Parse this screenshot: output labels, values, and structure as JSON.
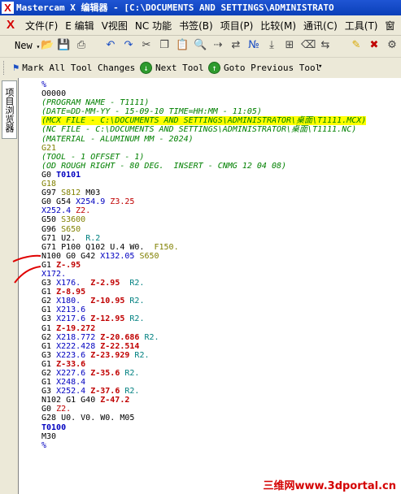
{
  "window": {
    "title": "Mastercam X 编辑器 - [C:\\DOCUMENTS AND SETTINGS\\ADMINISTRATO",
    "logo_char": "X"
  },
  "menubar": {
    "items": [
      "文件(F)",
      "E 编辑",
      "V视图",
      "NC 功能",
      "书签(B)",
      "项目(P)",
      "比较(M)",
      "通讯(C)",
      "工具(T)",
      "窗"
    ]
  },
  "toolbar1": {
    "new_label": "New",
    "icons": [
      "open-icon",
      "save-icon",
      "print-icon",
      "undo-icon",
      "redo-icon",
      "cut-icon",
      "copy-icon",
      "paste-icon",
      "find-icon",
      "find-next-icon",
      "replace-icon",
      "renumber-icon",
      "goto-icon",
      "insert-icon",
      "clear-icon",
      "compare-icon",
      "bookmark-icon",
      "send-icon",
      "tool-icon",
      "close-icon",
      "settings-icon"
    ]
  },
  "toolbar2": {
    "mark_all": "Mark All Tool Changes",
    "next_tool": "Next Tool",
    "goto_previous": "Goto Previous Tool"
  },
  "sidepanel": {
    "tab_label": "项目浏览器"
  },
  "code": {
    "lines": [
      [
        {
          "t": "%",
          "c": "gutter"
        }
      ],
      [
        {
          "t": "O0000",
          "c": "normal"
        }
      ],
      [
        {
          "t": "(PROGRAM NAME - T1111)",
          "c": "comment"
        }
      ],
      [
        {
          "t": "(DATE=DD-MM-YY - 15-09-10 TIME=HH:MM - 11:05)",
          "c": "comment"
        }
      ],
      [
        {
          "t": "(MCX FILE - C:\\DOCUMENTS AND SETTINGS\\ADMINISTRATOR\\桌面\\T1111.MCX)",
          "c": "comment hl"
        }
      ],
      [
        {
          "t": "(NC FILE - C:\\DOCUMENTS AND SETTINGS\\ADMINISTRATOR\\桌面\\T1111.NC)",
          "c": "comment"
        }
      ],
      [
        {
          "t": "(MATERIAL - ALUMINUM MM - 2024)",
          "c": "comment"
        }
      ],
      [
        {
          "t": "G21",
          "c": "olive"
        }
      ],
      [
        {
          "t": "(TOOL - 1 OFFSET - 1)",
          "c": "comment"
        }
      ],
      [
        {
          "t": "(OD ROUGH RIGHT - 80 DEG.  INSERT - CNMG 12 04 08)",
          "c": "comment"
        }
      ],
      [
        {
          "t": "G0 ",
          "c": "normal"
        },
        {
          "t": "T0101",
          "c": "blue bold"
        }
      ],
      [
        {
          "t": "G18",
          "c": "olive"
        }
      ],
      [
        {
          "t": "G97 ",
          "c": "normal"
        },
        {
          "t": "S812",
          "c": "olive"
        },
        {
          "t": " M03",
          "c": "normal"
        }
      ],
      [
        {
          "t": "G0 G54 ",
          "c": "normal"
        },
        {
          "t": "X254.9",
          "c": "blue"
        },
        {
          "t": " ",
          "c": "normal"
        },
        {
          "t": "Z3.25",
          "c": "red"
        }
      ],
      [
        {
          "t": "X252.4",
          "c": "blue"
        },
        {
          "t": " ",
          "c": "normal"
        },
        {
          "t": "Z2.",
          "c": "red"
        }
      ],
      [
        {
          "t": "G50 ",
          "c": "normal"
        },
        {
          "t": "S3600",
          "c": "olive"
        }
      ],
      [
        {
          "t": "G96 ",
          "c": "normal"
        },
        {
          "t": "S650",
          "c": "olive"
        }
      ],
      [
        {
          "t": "G71 U2.  ",
          "c": "normal"
        },
        {
          "t": "R.2",
          "c": "teal"
        }
      ],
      [
        {
          "t": "G71 P100 Q102 U.4 W0.  ",
          "c": "normal"
        },
        {
          "t": "F150.",
          "c": "olive"
        }
      ],
      [
        {
          "t": "N100 G0 G42 ",
          "c": "normal"
        },
        {
          "t": "X132.05",
          "c": "blue"
        },
        {
          "t": " ",
          "c": "normal"
        },
        {
          "t": "S650",
          "c": "olive"
        }
      ],
      [
        {
          "t": "G1 ",
          "c": "normal"
        },
        {
          "t": "Z-.95",
          "c": "red bold"
        }
      ],
      [
        {
          "t": "X172.",
          "c": "blue"
        }
      ],
      [
        {
          "t": "G3 ",
          "c": "normal"
        },
        {
          "t": "X176.",
          "c": "blue"
        },
        {
          "t": "  ",
          "c": "normal"
        },
        {
          "t": "Z-2.95",
          "c": "red bold"
        },
        {
          "t": "  ",
          "c": "normal"
        },
        {
          "t": "R2.",
          "c": "teal"
        }
      ],
      [
        {
          "t": "G1 ",
          "c": "normal"
        },
        {
          "t": "Z-8.95",
          "c": "red bold"
        }
      ],
      [
        {
          "t": "G2 ",
          "c": "normal"
        },
        {
          "t": "X180.",
          "c": "blue"
        },
        {
          "t": "  ",
          "c": "normal"
        },
        {
          "t": "Z-10.95",
          "c": "red bold"
        },
        {
          "t": " ",
          "c": "normal"
        },
        {
          "t": "R2.",
          "c": "teal"
        }
      ],
      [
        {
          "t": "G1 ",
          "c": "normal"
        },
        {
          "t": "X213.6",
          "c": "blue"
        }
      ],
      [
        {
          "t": "G3 ",
          "c": "normal"
        },
        {
          "t": "X217.6",
          "c": "blue"
        },
        {
          "t": " ",
          "c": "normal"
        },
        {
          "t": "Z-12.95",
          "c": "red bold"
        },
        {
          "t": " ",
          "c": "normal"
        },
        {
          "t": "R2.",
          "c": "teal"
        }
      ],
      [
        {
          "t": "G1 ",
          "c": "normal"
        },
        {
          "t": "Z-19.272",
          "c": "red bold"
        }
      ],
      [
        {
          "t": "G2 ",
          "c": "normal"
        },
        {
          "t": "X218.772",
          "c": "blue"
        },
        {
          "t": " ",
          "c": "normal"
        },
        {
          "t": "Z-20.686",
          "c": "red bold"
        },
        {
          "t": " ",
          "c": "normal"
        },
        {
          "t": "R2.",
          "c": "teal"
        }
      ],
      [
        {
          "t": "G1 ",
          "c": "normal"
        },
        {
          "t": "X222.428",
          "c": "blue"
        },
        {
          "t": " ",
          "c": "normal"
        },
        {
          "t": "Z-22.514",
          "c": "red bold"
        }
      ],
      [
        {
          "t": "G3 ",
          "c": "normal"
        },
        {
          "t": "X223.6",
          "c": "blue"
        },
        {
          "t": " ",
          "c": "normal"
        },
        {
          "t": "Z-23.929",
          "c": "red bold"
        },
        {
          "t": " ",
          "c": "normal"
        },
        {
          "t": "R2.",
          "c": "teal"
        }
      ],
      [
        {
          "t": "G1 ",
          "c": "normal"
        },
        {
          "t": "Z-33.6",
          "c": "red bold"
        }
      ],
      [
        {
          "t": "G2 ",
          "c": "normal"
        },
        {
          "t": "X227.6",
          "c": "blue"
        },
        {
          "t": " ",
          "c": "normal"
        },
        {
          "t": "Z-35.6",
          "c": "red bold"
        },
        {
          "t": " ",
          "c": "normal"
        },
        {
          "t": "R2.",
          "c": "teal"
        }
      ],
      [
        {
          "t": "G1 ",
          "c": "normal"
        },
        {
          "t": "X248.4",
          "c": "blue"
        }
      ],
      [
        {
          "t": "G3 ",
          "c": "normal"
        },
        {
          "t": "X252.4",
          "c": "blue"
        },
        {
          "t": " ",
          "c": "normal"
        },
        {
          "t": "Z-37.6",
          "c": "red bold"
        },
        {
          "t": " ",
          "c": "normal"
        },
        {
          "t": "R2.",
          "c": "teal"
        }
      ],
      [
        {
          "t": "N102 G1 G40 ",
          "c": "normal"
        },
        {
          "t": "Z-47.2",
          "c": "red bold"
        }
      ],
      [
        {
          "t": "G0 ",
          "c": "normal"
        },
        {
          "t": "Z2.",
          "c": "red"
        }
      ],
      [
        {
          "t": "G28 U0. V0. W0. M05",
          "c": "normal"
        }
      ],
      [
        {
          "t": "T0100",
          "c": "blue bold"
        }
      ],
      [
        {
          "t": "M30",
          "c": "normal"
        }
      ],
      [
        {
          "t": "%",
          "c": "gutter"
        }
      ]
    ]
  },
  "watermark": "三维网www.3dportal.cn",
  "colors": {
    "titlebar": "#0a3fb8",
    "highlight": "#ffff00",
    "annotation": "#e00000"
  }
}
